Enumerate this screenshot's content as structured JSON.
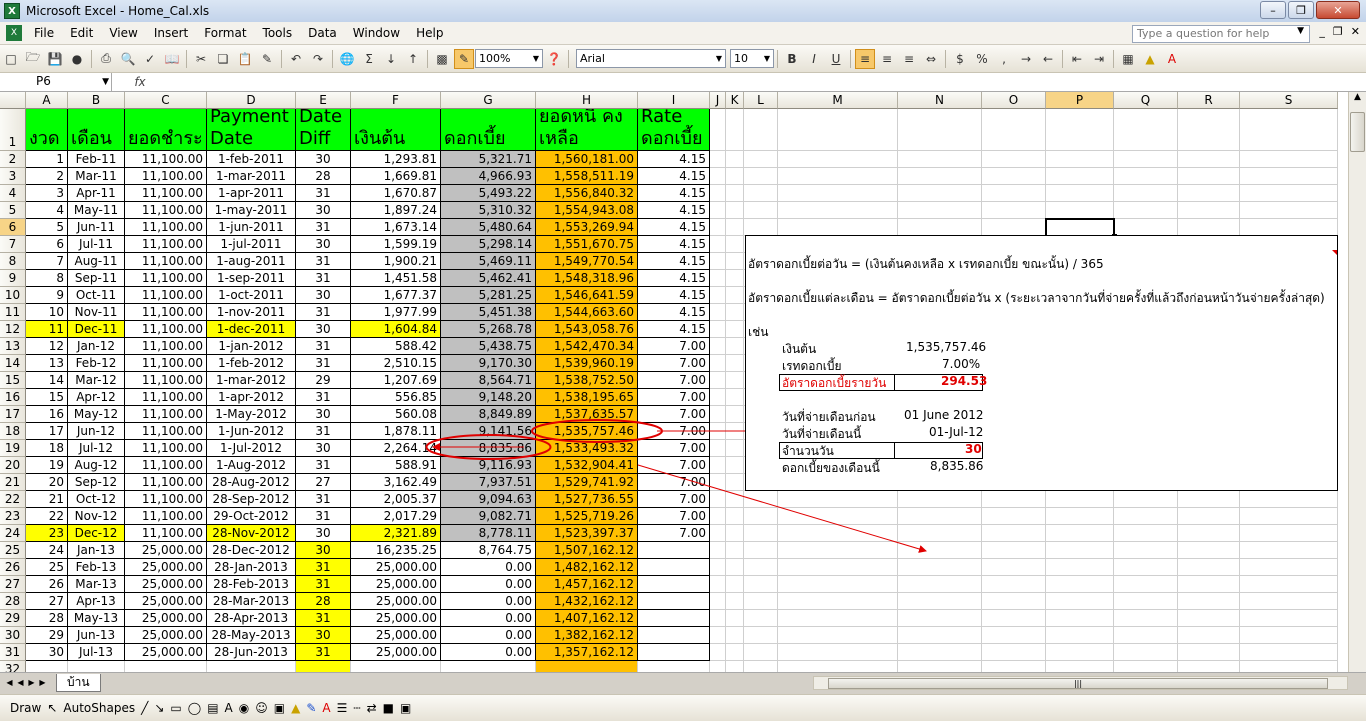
{
  "window": {
    "title": "Microsoft Excel - Home_Cal.xls"
  },
  "menu": [
    "File",
    "Edit",
    "View",
    "Insert",
    "Format",
    "Tools",
    "Data",
    "Window",
    "Help"
  ],
  "help_placeholder": "Type a question for help",
  "toolbar": {
    "zoom": "100%",
    "font": "Arial",
    "size": "10"
  },
  "namebox": "P6",
  "fx": "fx",
  "columns": [
    {
      "id": "A",
      "w": 42
    },
    {
      "id": "B",
      "w": 57
    },
    {
      "id": "C",
      "w": 82
    },
    {
      "id": "D",
      "w": 89
    },
    {
      "id": "E",
      "w": 55
    },
    {
      "id": "F",
      "w": 90
    },
    {
      "id": "G",
      "w": 95
    },
    {
      "id": "H",
      "w": 102
    },
    {
      "id": "I",
      "w": 72
    },
    {
      "id": "J",
      "w": 16
    },
    {
      "id": "K",
      "w": 18
    },
    {
      "id": "L",
      "w": 34
    },
    {
      "id": "M",
      "w": 120
    },
    {
      "id": "N",
      "w": 84
    },
    {
      "id": "O",
      "w": 64
    },
    {
      "id": "P",
      "w": 68
    },
    {
      "id": "Q",
      "w": 64
    },
    {
      "id": "R",
      "w": 62
    },
    {
      "id": "S",
      "w": 98
    }
  ],
  "header_row": [
    "งวด",
    "เดือน",
    "ยอดชำระ",
    "Payment Date",
    "Date Diff",
    "เงินต้น",
    "ดอกเบี้ย",
    "ยอดหนี้ คงเหลือ",
    "Rate ดอกเบี้ย"
  ],
  "rows": [
    [
      "1",
      "Feb-11",
      "11,100.00",
      "1-feb-2011",
      "30",
      "1,293.81",
      "5,321.71",
      "1,560,181.00",
      "4.15"
    ],
    [
      "2",
      "Mar-11",
      "11,100.00",
      "1-mar-2011",
      "28",
      "1,669.81",
      "4,966.93",
      "1,558,511.19",
      "4.15"
    ],
    [
      "3",
      "Apr-11",
      "11,100.00",
      "1-apr-2011",
      "31",
      "1,670.87",
      "5,493.22",
      "1,556,840.32",
      "4.15"
    ],
    [
      "4",
      "May-11",
      "11,100.00",
      "1-may-2011",
      "30",
      "1,897.24",
      "5,310.32",
      "1,554,943.08",
      "4.15"
    ],
    [
      "5",
      "Jun-11",
      "11,100.00",
      "1-jun-2011",
      "31",
      "1,673.14",
      "5,480.64",
      "1,553,269.94",
      "4.15"
    ],
    [
      "6",
      "Jul-11",
      "11,100.00",
      "1-jul-2011",
      "30",
      "1,599.19",
      "5,298.14",
      "1,551,670.75",
      "4.15"
    ],
    [
      "7",
      "Aug-11",
      "11,100.00",
      "1-aug-2011",
      "31",
      "1,900.21",
      "5,469.11",
      "1,549,770.54",
      "4.15"
    ],
    [
      "8",
      "Sep-11",
      "11,100.00",
      "1-sep-2011",
      "31",
      "1,451.58",
      "5,462.41",
      "1,548,318.96",
      "4.15"
    ],
    [
      "9",
      "Oct-11",
      "11,100.00",
      "1-oct-2011",
      "30",
      "1,677.37",
      "5,281.25",
      "1,546,641.59",
      "4.15"
    ],
    [
      "10",
      "Nov-11",
      "11,100.00",
      "1-nov-2011",
      "31",
      "1,977.99",
      "5,451.38",
      "1,544,663.60",
      "4.15"
    ],
    [
      "11",
      "Dec-11",
      "11,100.00",
      "1-dec-2011",
      "30",
      "1,604.84",
      "5,268.78",
      "1,543,058.76",
      "4.15"
    ],
    [
      "12",
      "Jan-12",
      "11,100.00",
      "1-jan-2012",
      "31",
      "588.42",
      "5,438.75",
      "1,542,470.34",
      "7.00"
    ],
    [
      "13",
      "Feb-12",
      "11,100.00",
      "1-feb-2012",
      "31",
      "2,510.15",
      "9,170.30",
      "1,539,960.19",
      "7.00"
    ],
    [
      "14",
      "Mar-12",
      "11,100.00",
      "1-mar-2012",
      "29",
      "1,207.69",
      "8,564.71",
      "1,538,752.50",
      "7.00"
    ],
    [
      "15",
      "Apr-12",
      "11,100.00",
      "1-apr-2012",
      "31",
      "556.85",
      "9,148.20",
      "1,538,195.65",
      "7.00"
    ],
    [
      "16",
      "May-12",
      "11,100.00",
      "1-May-2012",
      "30",
      "560.08",
      "8,849.89",
      "1,537,635.57",
      "7.00"
    ],
    [
      "17",
      "Jun-12",
      "11,100.00",
      "1-Jun-2012",
      "31",
      "1,878.11",
      "9,141.56",
      "1,535,757.46",
      "7.00"
    ],
    [
      "18",
      "Jul-12",
      "11,100.00",
      "1-Jul-2012",
      "30",
      "2,264.14",
      "8,835.86",
      "1,533,493.32",
      "7.00"
    ],
    [
      "19",
      "Aug-12",
      "11,100.00",
      "1-Aug-2012",
      "31",
      "588.91",
      "9,116.93",
      "1,532,904.41",
      "7.00"
    ],
    [
      "20",
      "Sep-12",
      "11,100.00",
      "28-Aug-2012",
      "27",
      "3,162.49",
      "7,937.51",
      "1,529,741.92",
      "7.00"
    ],
    [
      "21",
      "Oct-12",
      "11,100.00",
      "28-Sep-2012",
      "31",
      "2,005.37",
      "9,094.63",
      "1,527,736.55",
      "7.00"
    ],
    [
      "22",
      "Nov-12",
      "11,100.00",
      "29-Oct-2012",
      "31",
      "2,017.29",
      "9,082.71",
      "1,525,719.26",
      "7.00"
    ],
    [
      "23",
      "Dec-12",
      "11,100.00",
      "28-Nov-2012",
      "30",
      "2,321.89",
      "8,778.11",
      "1,523,397.37",
      "7.00"
    ],
    [
      "24",
      "Jan-13",
      "25,000.00",
      "28-Dec-2012",
      "30",
      "16,235.25",
      "8,764.75",
      "1,507,162.12",
      ""
    ],
    [
      "25",
      "Feb-13",
      "25,000.00",
      "28-Jan-2013",
      "31",
      "25,000.00",
      "0.00",
      "1,482,162.12",
      ""
    ],
    [
      "26",
      "Mar-13",
      "25,000.00",
      "28-Feb-2013",
      "31",
      "25,000.00",
      "0.00",
      "1,457,162.12",
      ""
    ],
    [
      "27",
      "Apr-13",
      "25,000.00",
      "28-Mar-2013",
      "28",
      "25,000.00",
      "0.00",
      "1,432,162.12",
      ""
    ],
    [
      "28",
      "May-13",
      "25,000.00",
      "28-Apr-2013",
      "31",
      "25,000.00",
      "0.00",
      "1,407,162.12",
      ""
    ],
    [
      "29",
      "Jun-13",
      "25,000.00",
      "28-May-2013",
      "30",
      "25,000.00",
      "0.00",
      "1,382,162.12",
      ""
    ],
    [
      "30",
      "Jul-13",
      "25,000.00",
      "28-Jun-2013",
      "31",
      "25,000.00",
      "0.00",
      "1,357,162.12",
      ""
    ]
  ],
  "note": {
    "line1": "อัตราดอกเบี้ยต่อวัน = (เงินต้นคงเหลือ x เรทดอกเบี้ย ขณะนั้น) / 365",
    "line2": "อัตราดอกเบี้ยแต่ละเดือน = อัตราดอกเบี้ยต่อวัน x (ระยะเวลาจากวันที่จ่ายครั้งที่แล้วถึงก่อนหน้าวันจ่ายครั้งล่าสุด)",
    "example": "เช่น",
    "principal_label": "เงินต้น",
    "principal_value": "1,535,757.46",
    "rate_label": "เรทดอกเบี้ย",
    "rate_value": "7.00%",
    "daily_label": "อัตราดอกเบี้ยรายวัน",
    "daily_value": "294.53",
    "prev_label": "วันที่จ่ายเดือนก่อน",
    "prev_value": "01 June 2012",
    "this_label": "วันที่จ่ายเดือนนี้",
    "this_value": "01-Jul-12",
    "days_label": "จำนวนวัน",
    "days_value": "30",
    "interest_label": "ดอกเบี้ยของเดือนนี้",
    "interest_value": "8,835.86"
  },
  "sheet_tab": "บ้าน",
  "drawbar": {
    "draw": "Draw",
    "autoshapes": "AutoShapes"
  }
}
